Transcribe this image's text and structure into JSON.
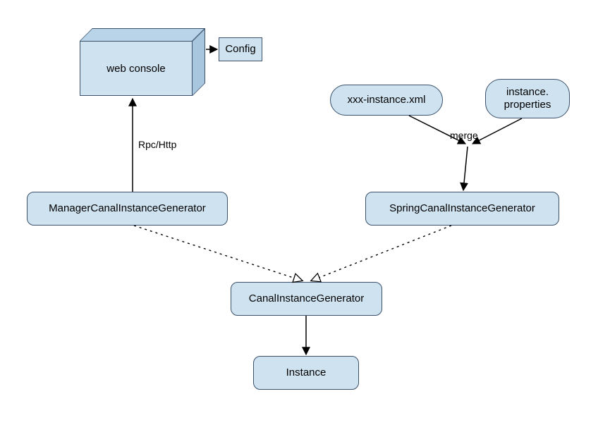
{
  "nodes": {
    "web_console": "web console",
    "config": "Config",
    "xxx_instance": "xxx-instance.xml",
    "instance_properties": "instance.\nproperties",
    "manager_generator": "ManagerCanalInstanceGenerator",
    "spring_generator": "SpringCanalInstanceGenerator",
    "canal_generator": "CanalInstanceGenerator",
    "instance": "Instance"
  },
  "edge_labels": {
    "rpc_http": "Rpc/Http",
    "merge": "merge"
  },
  "colors": {
    "node_fill": "#cfe2f0",
    "node_stroke": "#3a506b"
  }
}
